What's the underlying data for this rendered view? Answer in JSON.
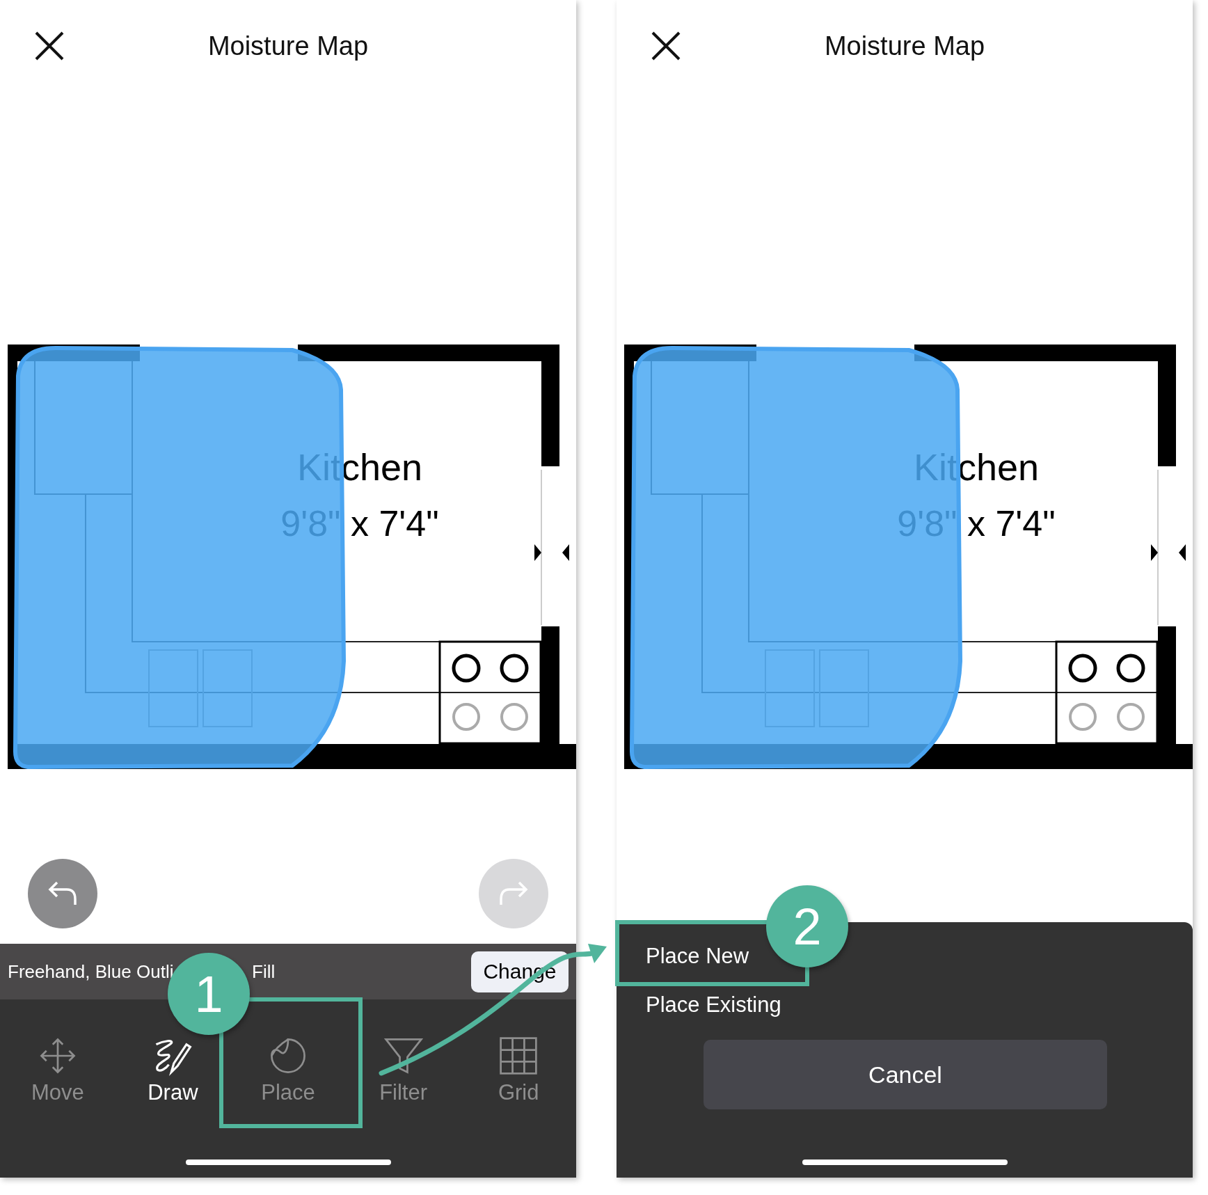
{
  "screens": [
    {
      "kind": "toolbar",
      "title": "Moisture Map",
      "room": {
        "name": "Kitchen",
        "dimensions": "9'8\" x 7'4\""
      },
      "history": {
        "undo": {
          "disabled": false
        },
        "redo": {
          "disabled": true
        }
      },
      "status": {
        "text": "Freehand, Blue Outli",
        "text_end": "Fill",
        "button": "Change"
      },
      "tools": [
        {
          "kind": "move",
          "label": "Move",
          "selected": false
        },
        {
          "kind": "draw",
          "label": "Draw",
          "selected": true
        },
        {
          "kind": "place",
          "label": "Place",
          "selected": false
        },
        {
          "kind": "filter",
          "label": "Filter",
          "selected": false
        },
        {
          "kind": "grid",
          "label": "Grid",
          "selected": false
        }
      ]
    },
    {
      "kind": "sheet",
      "title": "Moisture Map",
      "room": {
        "name": "Kitchen",
        "dimensions": "9'8\" x 7'4\""
      },
      "sheet": {
        "options": [
          "Place New",
          "Place Existing"
        ],
        "cancel": "Cancel"
      }
    }
  ],
  "annotations": [
    {
      "number": "1"
    },
    {
      "number": "2"
    }
  ]
}
